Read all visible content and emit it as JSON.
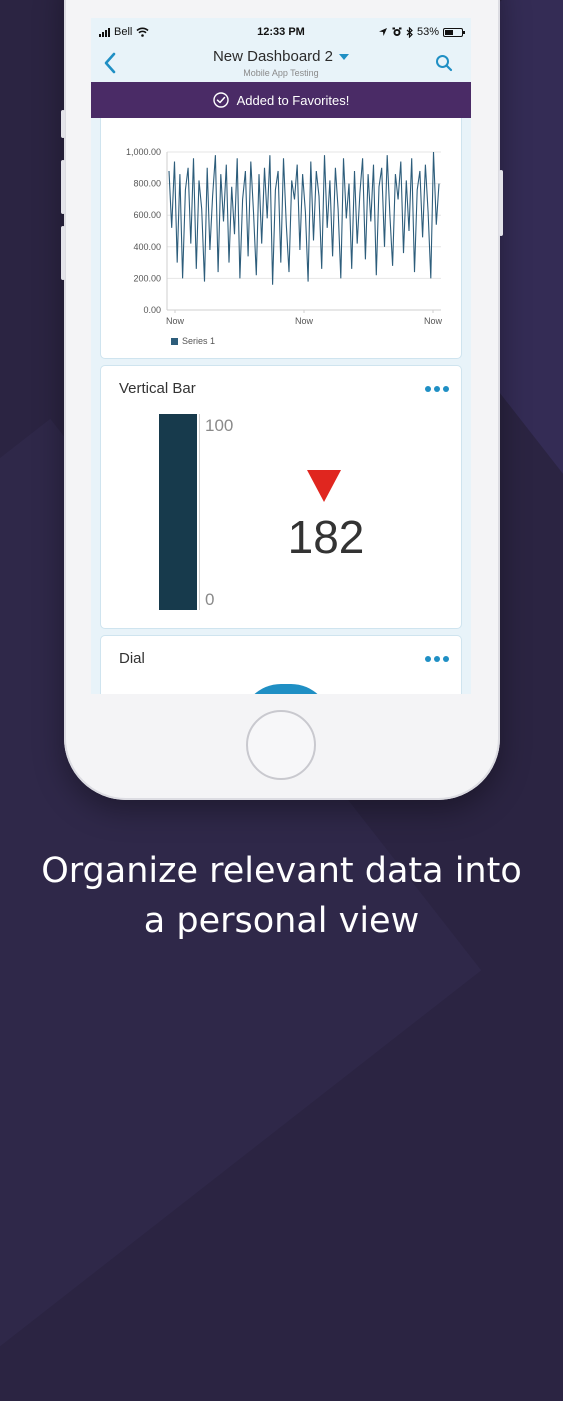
{
  "status_bar": {
    "carrier": "Bell",
    "time": "12:33 PM",
    "battery": "53%",
    "battery_level": 0.53,
    "icons": [
      "signal-icon",
      "wifi-icon",
      "location-icon",
      "alarm-icon",
      "bluetooth-icon",
      "battery-icon"
    ]
  },
  "nav": {
    "title": "New Dashboard 2",
    "subtitle": "Mobile App Testing",
    "icons": [
      "back-icon",
      "chevron-down-icon",
      "search-icon"
    ]
  },
  "banner": {
    "text": "Added to Favorites!",
    "icon": "check-circle-icon"
  },
  "colors": {
    "accent": "#1f8fc4",
    "banner": "#4a2b66",
    "series": "#2d5d7b",
    "bar_fill": "#173a4c",
    "trend_down": "#e0261f"
  },
  "chart_data": {
    "type": "line",
    "y_ticks": [
      "1,000.00",
      "800.00",
      "600.00",
      "400.00",
      "200.00",
      "0.00"
    ],
    "x_ticks": [
      "Now",
      "Now",
      "Now"
    ],
    "ylim": [
      0,
      1000
    ],
    "grid": true,
    "legend_position": "bottom-left",
    "series": [
      {
        "name": "Series 1",
        "values": [
          880,
          520,
          940,
          300,
          860,
          200,
          760,
          900,
          420,
          960,
          260,
          820,
          640,
          180,
          900,
          380,
          720,
          980,
          240,
          860,
          560,
          920,
          300,
          780,
          480,
          960,
          200,
          700,
          880,
          340,
          940,
          620,
          220,
          860,
          420,
          900,
          580,
          980,
          160,
          760,
          880,
          300,
          960,
          540,
          240,
          820,
          700,
          920,
          380,
          860,
          620,
          180,
          940,
          440,
          880,
          720,
          260,
          980,
          520,
          820,
          340,
          900,
          640,
          200,
          960,
          580,
          800,
          260,
          880,
          420,
          740,
          960,
          320,
          860,
          560,
          920,
          220,
          780,
          900,
          400,
          980,
          600,
          280,
          860,
          700,
          940,
          360,
          820,
          500,
          960,
          240,
          760,
          880,
          460,
          920,
          620,
          200,
          1000,
          540,
          800
        ]
      }
    ]
  },
  "vertical_bar": {
    "title": "Vertical Bar",
    "max_label": "100",
    "min_label": "0",
    "fill_fraction": 1.0,
    "value": "182",
    "trend": "down"
  },
  "dial": {
    "title": "Dial"
  },
  "caption": {
    "line1": "Organize relevant data into",
    "line2": "a personal view"
  }
}
